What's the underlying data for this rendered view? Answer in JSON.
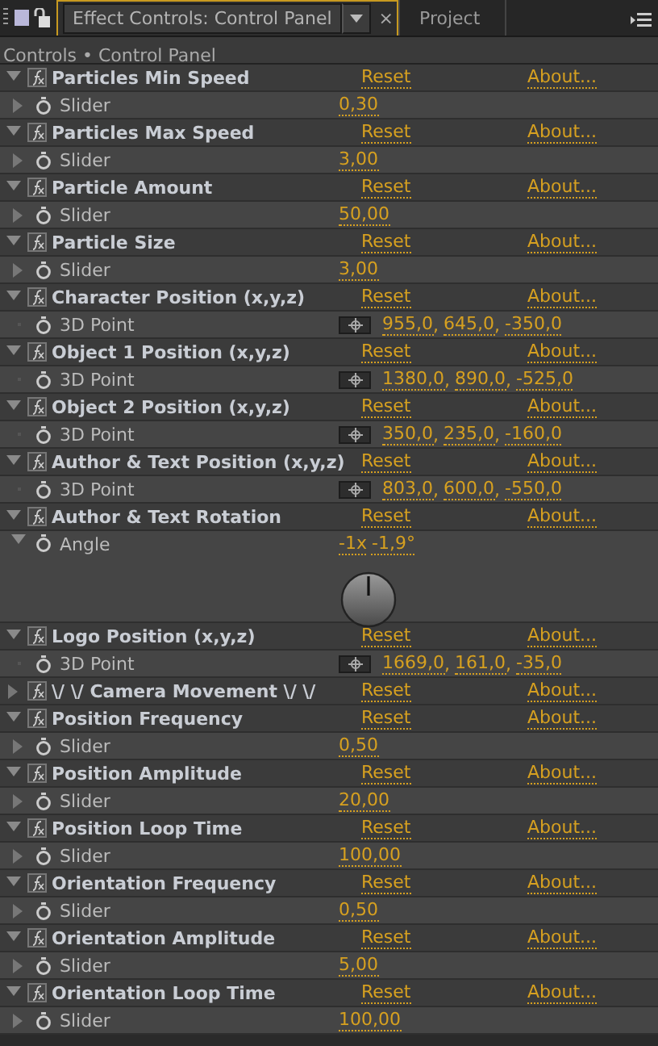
{
  "tabs": [
    {
      "label": "Effect Controls: Control Panel",
      "selected": true,
      "close": "×"
    },
    {
      "label": "Project",
      "selected": false
    }
  ],
  "breadcrumb": "Controls • Control Panel",
  "effects": [
    {
      "name": "Particles Min Speed",
      "expanded": true,
      "reset": "Reset",
      "about": "About...",
      "param": {
        "kind": "slider",
        "label": "Slider",
        "expanded": false,
        "values": [
          "0,30"
        ]
      }
    },
    {
      "name": "Particles Max Speed",
      "expanded": true,
      "reset": "Reset",
      "about": "About...",
      "param": {
        "kind": "slider",
        "label": "Slider",
        "expanded": false,
        "values": [
          "3,00"
        ]
      }
    },
    {
      "name": "Particle Amount",
      "expanded": true,
      "reset": "Reset",
      "about": "About...",
      "param": {
        "kind": "slider",
        "label": "Slider",
        "expanded": false,
        "values": [
          "50,00"
        ]
      }
    },
    {
      "name": "Particle Size",
      "expanded": true,
      "reset": "Reset",
      "about": "About...",
      "param": {
        "kind": "slider",
        "label": "Slider",
        "expanded": false,
        "values": [
          "3,00"
        ]
      }
    },
    {
      "name": "Character Position (x,y,z)",
      "expanded": true,
      "reset": "Reset",
      "about": "About...",
      "param": {
        "kind": "point",
        "label": "3D Point",
        "separator": ",",
        "values": [
          "955,0",
          "645,0",
          "-350,0"
        ]
      }
    },
    {
      "name": "Object 1 Position (x,y,z)",
      "expanded": true,
      "reset": "Reset",
      "about": "About...",
      "param": {
        "kind": "point",
        "label": "3D Point",
        "separator": ",",
        "values": [
          "1380,0",
          "890,0",
          "-525,0"
        ]
      }
    },
    {
      "name": "Object 2 Position (x,y,z)",
      "expanded": true,
      "reset": "Reset",
      "about": "About...",
      "param": {
        "kind": "point",
        "label": "3D Point",
        "separator": ",",
        "values": [
          "350,0",
          "235,0",
          "-160,0"
        ]
      }
    },
    {
      "name": "Author & Text Position (x,y,z)",
      "expanded": true,
      "reset": "Reset",
      "about": "About...",
      "param": {
        "kind": "point",
        "label": "3D Point",
        "separator": ",",
        "values": [
          "803,0",
          "600,0",
          "-550,0"
        ]
      }
    },
    {
      "name": "Author & Text Rotation",
      "expanded": true,
      "reset": "Reset",
      "about": "About...",
      "param": {
        "kind": "angle",
        "label": "Angle",
        "expanded": true,
        "values": [
          "-1x",
          "-1,9°"
        ]
      }
    },
    {
      "name": "Logo Position (x,y,z)",
      "expanded": true,
      "reset": "Reset",
      "about": "About...",
      "param": {
        "kind": "point",
        "label": "3D Point",
        "separator": ",",
        "values": [
          "1669,0",
          "161,0",
          "-35,0"
        ]
      }
    },
    {
      "name": "\\/ \\/ Camera Movement \\/ \\/",
      "expanded": false,
      "reset": "Reset",
      "about": "About..."
    },
    {
      "name": "Position Frequency",
      "expanded": true,
      "reset": "Reset",
      "about": "About...",
      "param": {
        "kind": "slider",
        "label": "Slider",
        "expanded": false,
        "values": [
          "0,50"
        ]
      }
    },
    {
      "name": "Position Amplitude",
      "expanded": true,
      "reset": "Reset",
      "about": "About...",
      "param": {
        "kind": "slider",
        "label": "Slider",
        "expanded": false,
        "values": [
          "20,00"
        ]
      }
    },
    {
      "name": "Position Loop Time",
      "expanded": true,
      "reset": "Reset",
      "about": "About...",
      "param": {
        "kind": "slider",
        "label": "Slider",
        "expanded": false,
        "values": [
          "100,00"
        ]
      }
    },
    {
      "name": "Orientation Frequency",
      "expanded": true,
      "reset": "Reset",
      "about": "About...",
      "param": {
        "kind": "slider",
        "label": "Slider",
        "expanded": false,
        "values": [
          "0,50"
        ]
      }
    },
    {
      "name": "Orientation Amplitude",
      "expanded": true,
      "reset": "Reset",
      "about": "About...",
      "param": {
        "kind": "slider",
        "label": "Slider",
        "expanded": false,
        "values": [
          "5,00"
        ]
      }
    },
    {
      "name": "Orientation Loop Time",
      "expanded": true,
      "reset": "Reset",
      "about": "About...",
      "param": {
        "kind": "slider",
        "label": "Slider",
        "expanded": false,
        "values": [
          "100,00"
        ]
      }
    }
  ]
}
